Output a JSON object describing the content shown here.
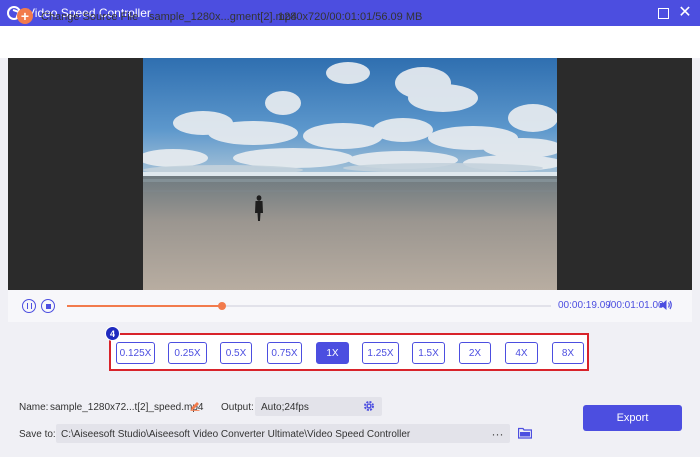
{
  "window": {
    "title": "Video Speed Controller"
  },
  "toolbar": {
    "change_source_label": "Change Source File",
    "file_name": "sample_1280x...gment[2].mp4",
    "file_info": "1280x720/00:01:01/56.09 MB"
  },
  "playback": {
    "current_time": "00:00:19.09",
    "total_time": "/00:01:01.00",
    "progress_fraction": 0.32
  },
  "speed": {
    "badge": "4",
    "options": [
      "0.125X",
      "0.25X",
      "0.5X",
      "0.75X",
      "1X",
      "1.25X",
      "1.5X",
      "2X",
      "4X",
      "8X"
    ],
    "selected": "1X"
  },
  "output": {
    "name_label": "Name:",
    "name_value": "sample_1280x72...t[2]_speed.mp4",
    "output_label": "Output:",
    "output_value": "Auto;24fps",
    "save_label": "Save to:",
    "save_path": "C:\\Aiseesoft Studio\\Aiseesoft Video Converter Ultimate\\Video Speed Controller",
    "browse_label": "···",
    "export_label": "Export"
  },
  "colors": {
    "accent": "#4c4ee0",
    "progress": "#f27b4c",
    "highlight_border": "#d8232a"
  },
  "icons": [
    "app-logo-icon",
    "maximize-icon",
    "close-icon",
    "add-icon",
    "pause-icon",
    "stop-icon",
    "volume-icon",
    "edit-icon",
    "gear-icon",
    "folder-icon"
  ]
}
